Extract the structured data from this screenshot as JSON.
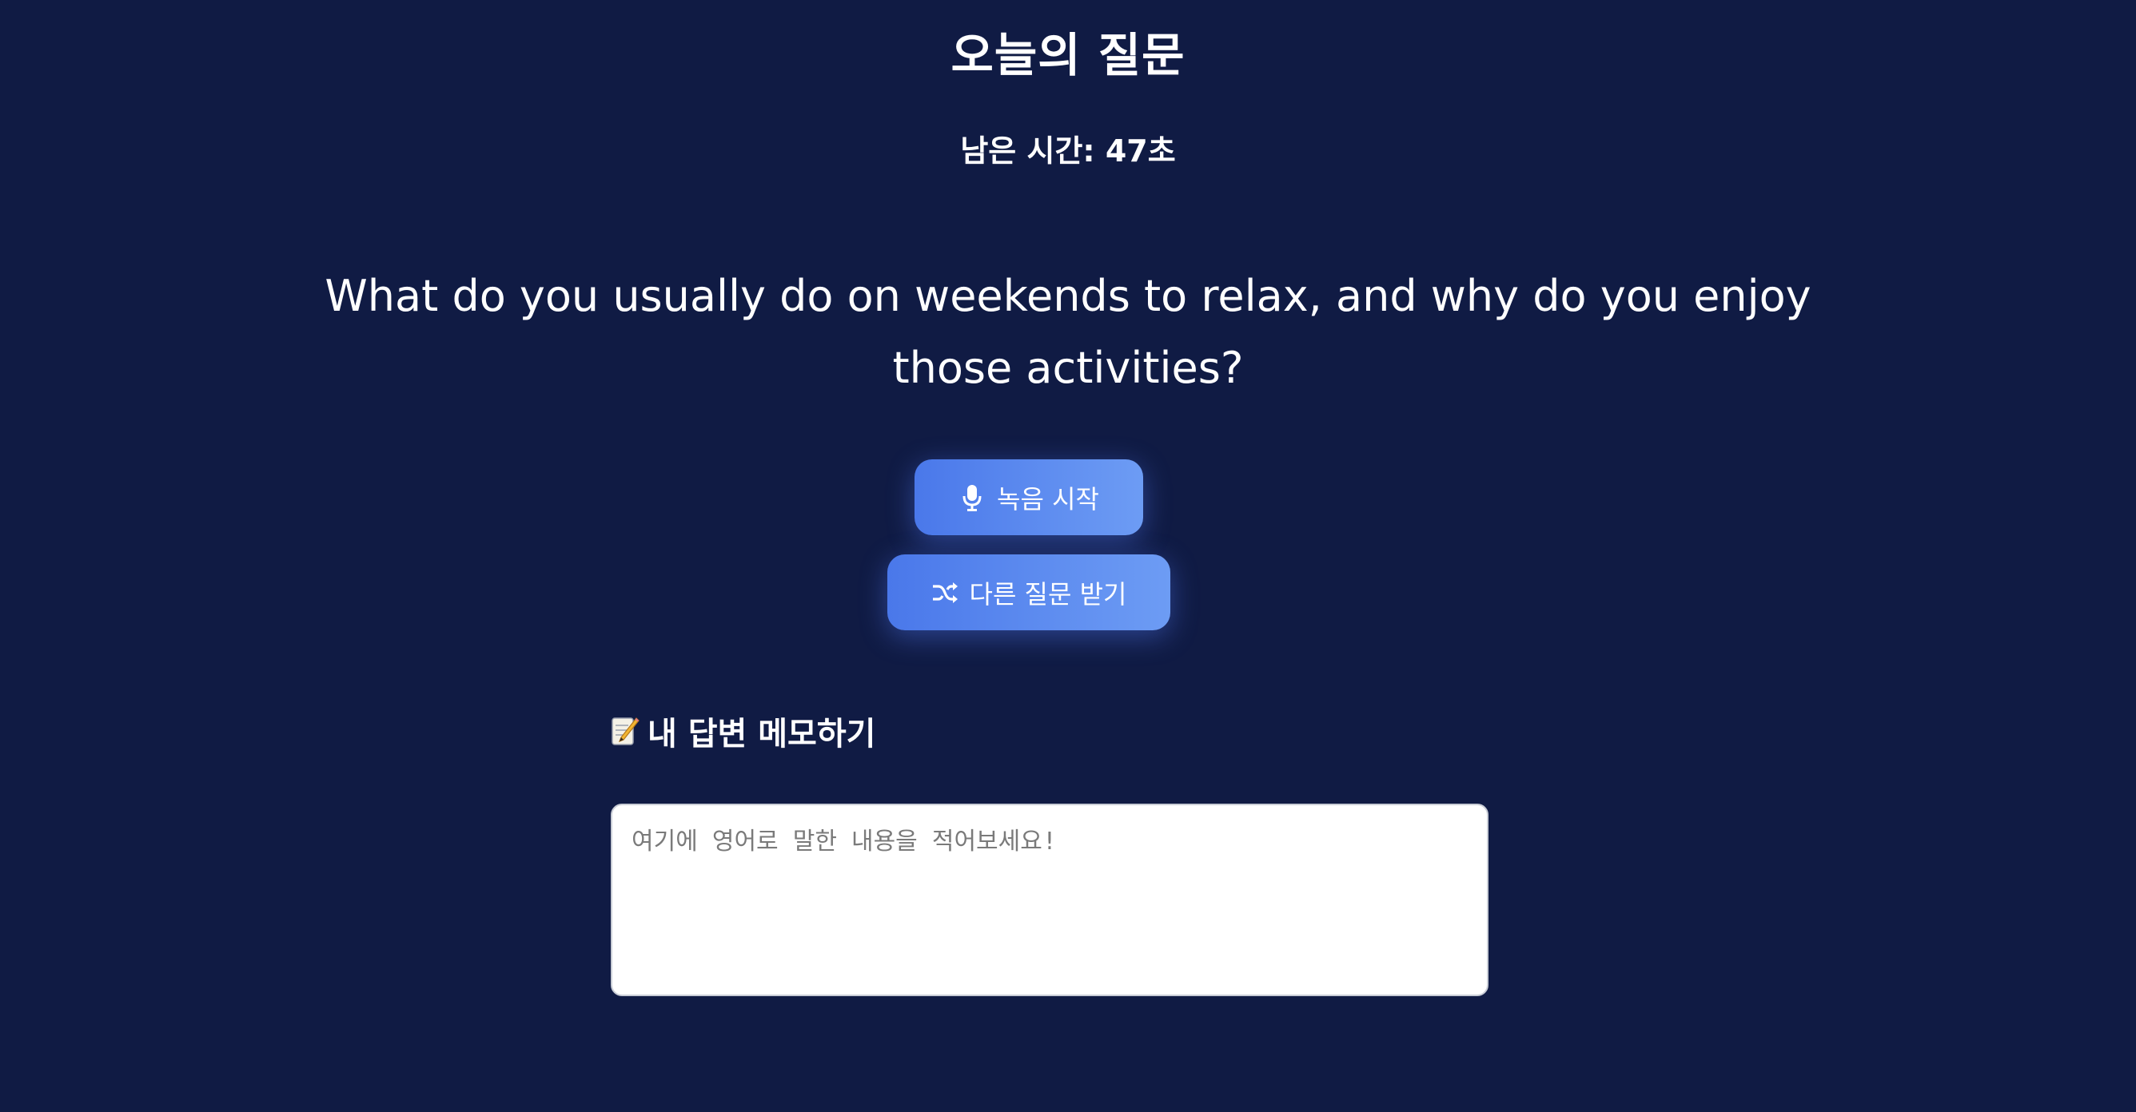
{
  "header": {
    "title": "오늘의 질문",
    "timer_text": "남은 시간: 47초"
  },
  "question": {
    "text": "What do you usually do on weekends to relax, and why do you enjoy those activities?"
  },
  "buttons": {
    "record": {
      "label": "녹음 시작",
      "icon": "microphone-icon"
    },
    "shuffle": {
      "label": "다른 질문 받기",
      "icon": "shuffle-icon"
    }
  },
  "memo": {
    "label": "내 답변 메모하기",
    "icon": "memo-icon",
    "value": "",
    "placeholder": "여기에 영어로 말한 내용을 적어보세요!"
  },
  "colors": {
    "background": "#101b44",
    "button_start": "#4a78ea",
    "button_end": "#6d9cf4"
  }
}
